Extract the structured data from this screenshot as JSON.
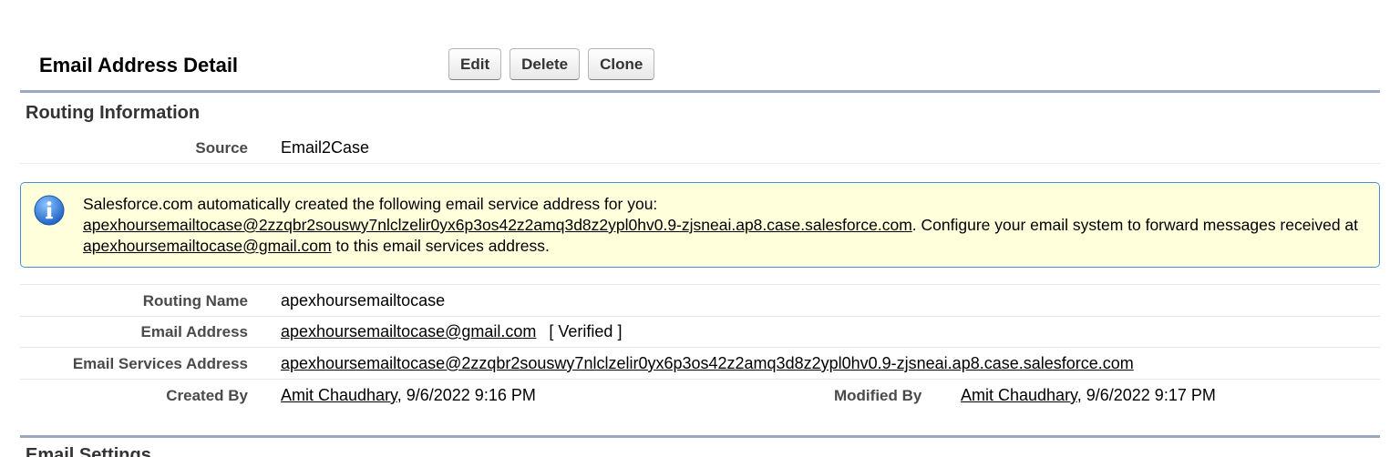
{
  "header": {
    "title": "Email Address Detail",
    "buttons": {
      "edit": "Edit",
      "delete": "Delete",
      "clone": "Clone"
    }
  },
  "routing": {
    "section_title": "Routing Information",
    "source_label": "Source",
    "source_value": "Email2Case"
  },
  "info": {
    "icon": "info-icon",
    "line1": "Salesforce.com automatically created the following email service address for you:",
    "service_address": "apexhoursemailtocase@2zzqbr2souswy7nlclzelir0yx6p3os42z2amq3d8z2ypl0hv0.9-zjsneai.ap8.case.salesforce.com",
    "after_address": ". Configure your email system to forward messages received at ",
    "email": "apexhoursemailtocase@gmail.com",
    "tail": " to this email services address."
  },
  "fields": {
    "routing_name_label": "Routing Name",
    "routing_name_value": "apexhoursemailtocase",
    "email_address_label": "Email Address",
    "email_address_value": "apexhoursemailtocase@gmail.com",
    "verified": "[ Verified ]",
    "services_address_label": "Email Services Address",
    "services_address_value": "apexhoursemailtocase@2zzqbr2souswy7nlclzelir0yx6p3os42z2amq3d8z2ypl0hv0.9-zjsneai.ap8.case.salesforce.com",
    "created_by_label": "Created By",
    "created_by_user": "Amit Chaudhary",
    "created_by_date": ", 9/6/2022 9:16 PM",
    "modified_by_label": "Modified By",
    "modified_by_user": "Amit Chaudhary",
    "modified_by_date": ", 9/6/2022 9:17 PM"
  },
  "email_settings": {
    "section_title": "Email Settings"
  },
  "colors": {
    "rule": "#9aa7c2",
    "info_bg": "#ffffdc",
    "info_border": "#4a90d9",
    "icon_blue": "#2e7bd6"
  }
}
